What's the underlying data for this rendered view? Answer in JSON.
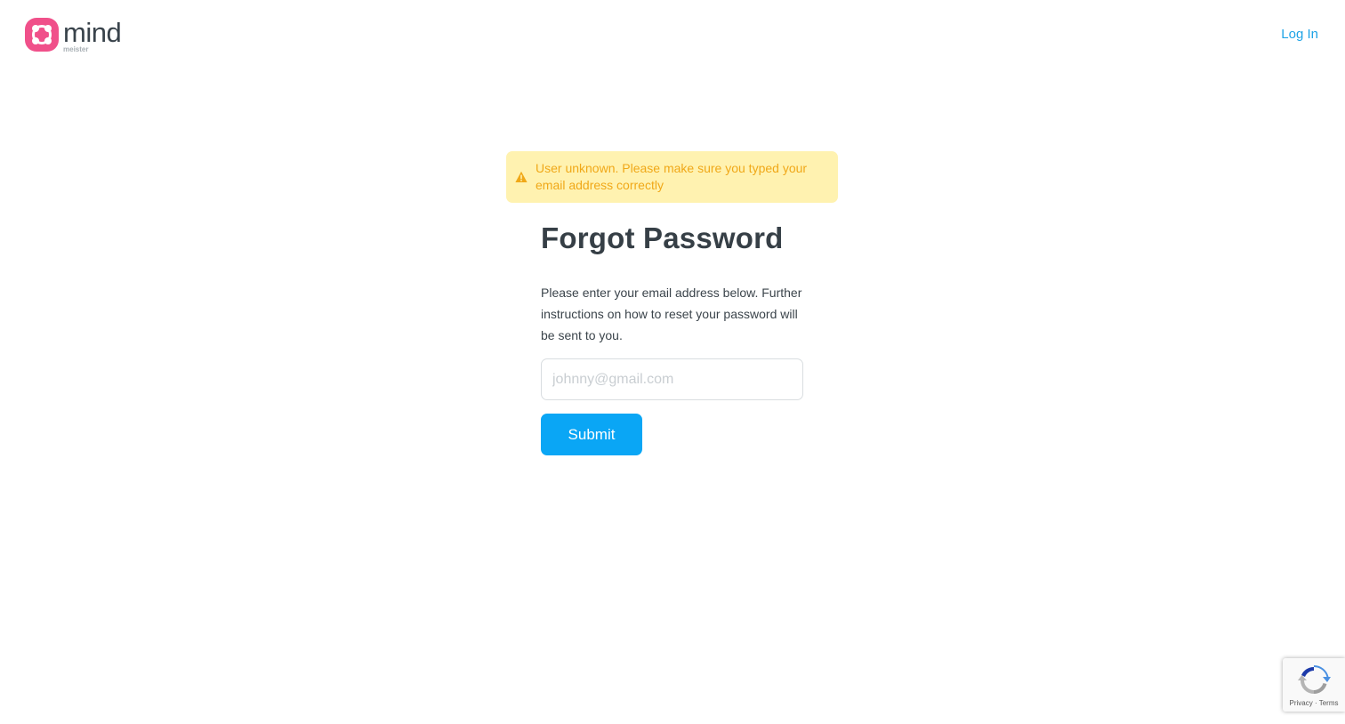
{
  "header": {
    "logo": {
      "word": "mind",
      "subword": "meister",
      "icon": "mindmeister-logo-icon",
      "brand_color": "#f0508a"
    },
    "login_label": "Log In",
    "link_color": "#1ea3e6"
  },
  "alert": {
    "icon": "warning-triangle-icon",
    "message": "User unknown. Please make sure you typed your email address correctly",
    "background": "#fff2b0",
    "text_color": "#f0a818"
  },
  "form": {
    "title": "Forgot Password",
    "instructions": "Please enter your email address below. Further instructions on how to reset your password will be sent to you.",
    "email": {
      "value": "",
      "placeholder": "johnny@gmail.com"
    },
    "submit_label": "Submit",
    "button_color": "#0aa6f5"
  },
  "recaptcha": {
    "icon": "recaptcha-icon",
    "privacy_label": "Privacy",
    "separator": "·",
    "terms_label": "Terms"
  }
}
